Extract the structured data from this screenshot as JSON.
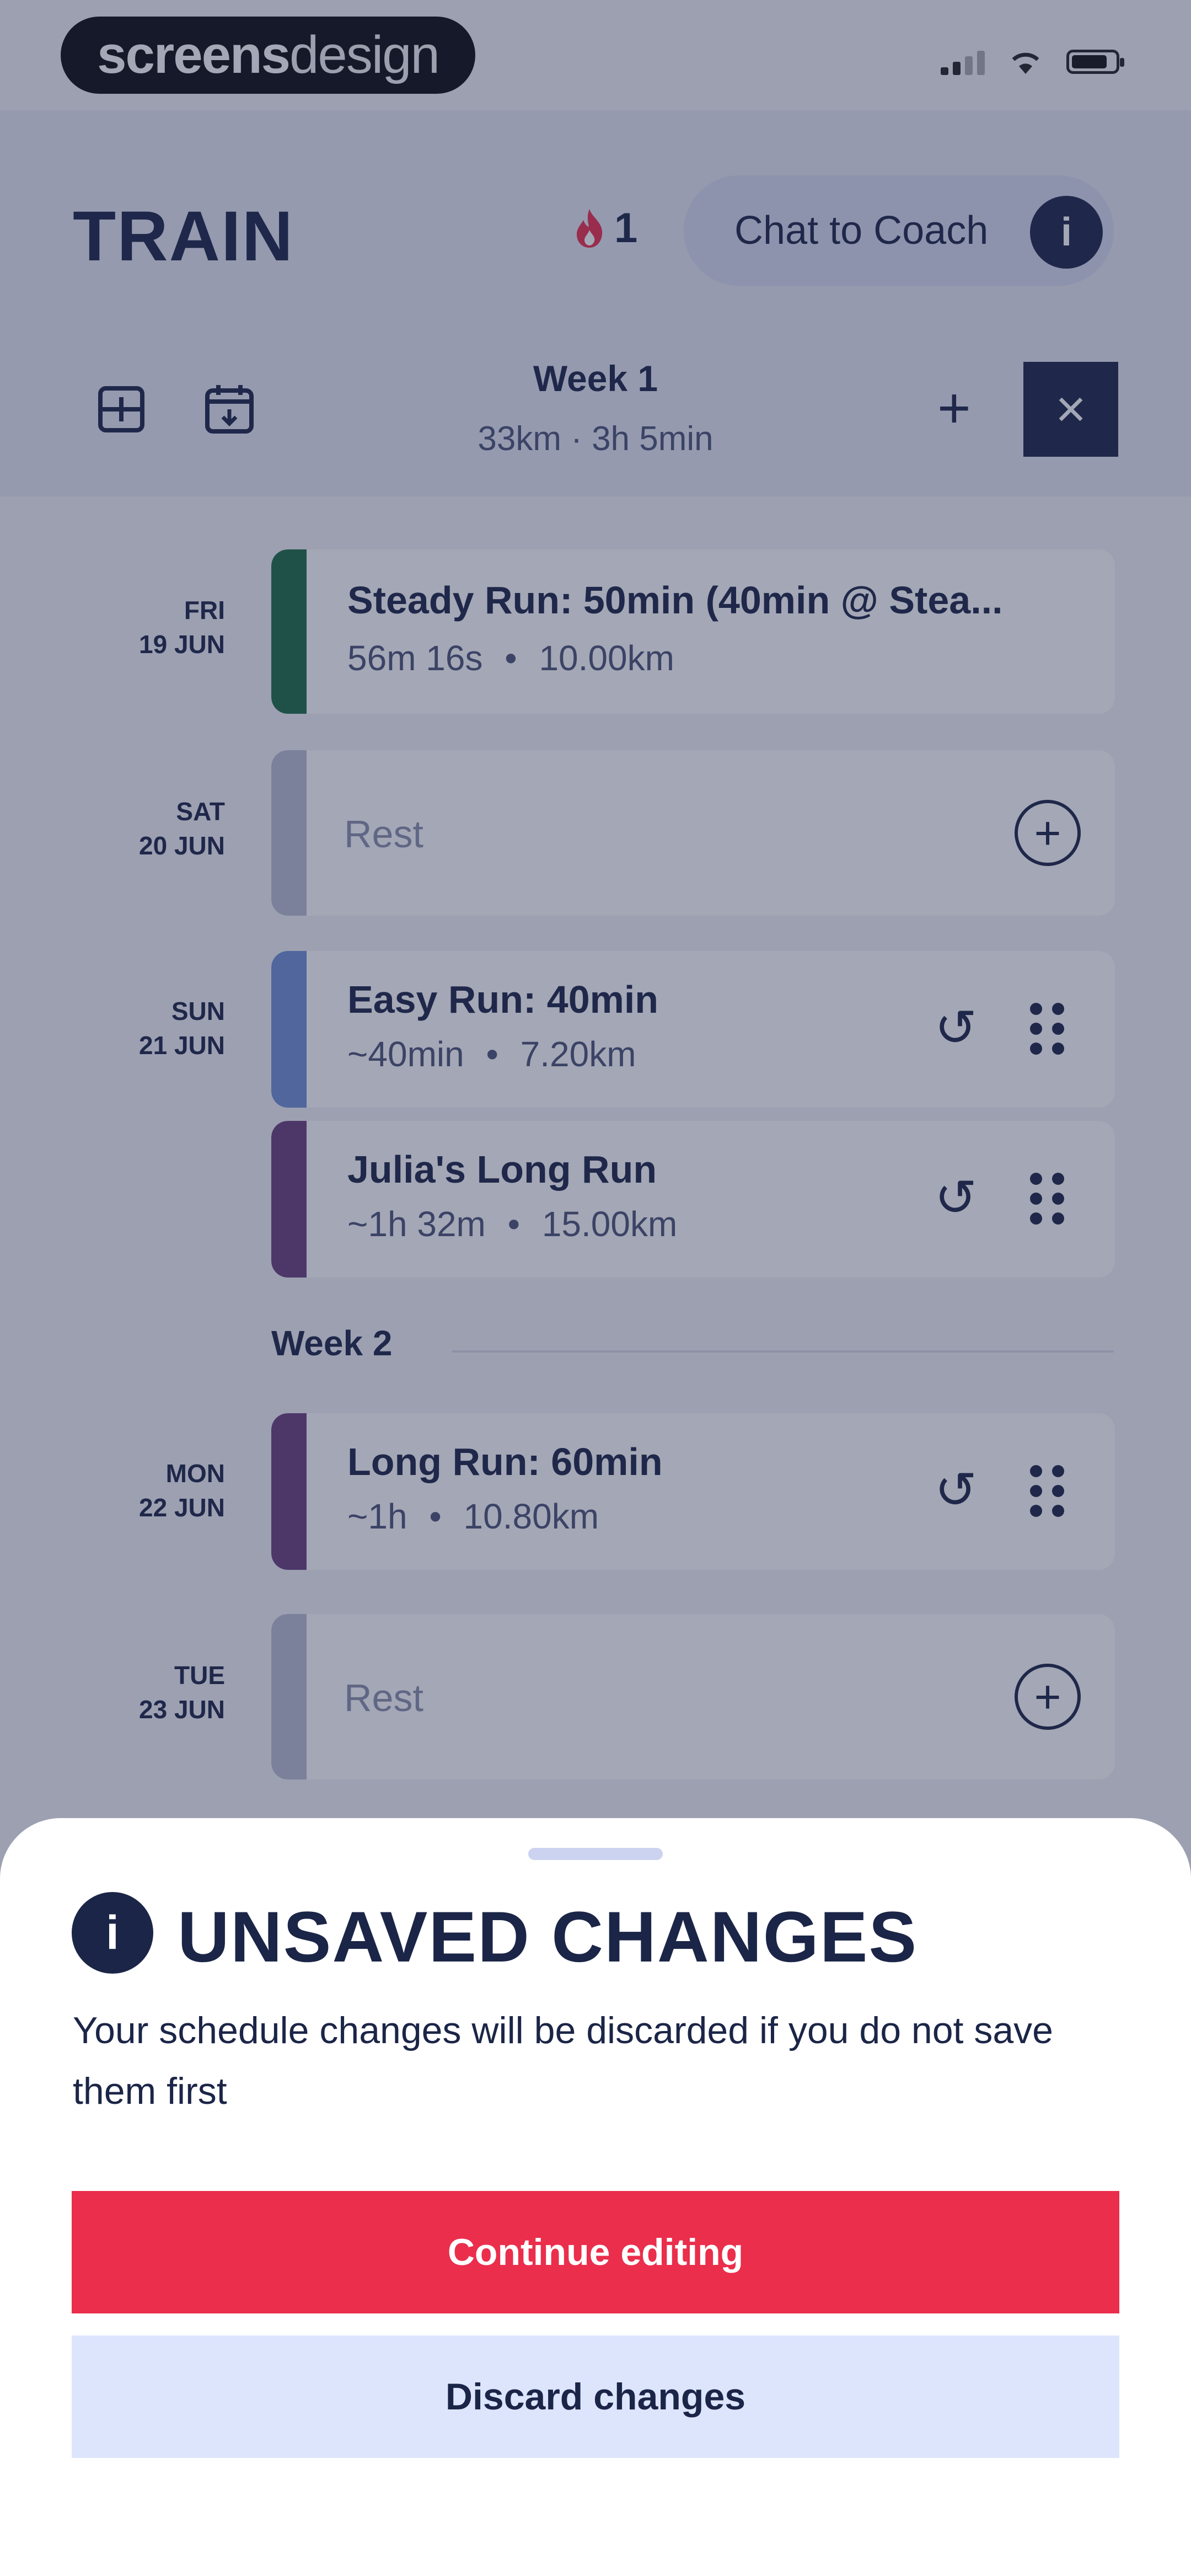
{
  "status_bar": {
    "brand_bold": "screens",
    "brand_light": "design"
  },
  "header": {
    "title": "TRAIN",
    "streak_count": "1",
    "chat_button_label": "Chat to Coach",
    "chat_info_glyph": "i"
  },
  "week_bar": {
    "week_title": "Week 1",
    "week_summary": "33km · 3h 5min",
    "plus_glyph": "+",
    "close_glyph": "×"
  },
  "schedule": {
    "days": [
      {
        "day": "FRI",
        "date": "19 JUN"
      },
      {
        "day": "SAT",
        "date": "20 JUN"
      },
      {
        "day": "SUN",
        "date": "21 JUN"
      },
      {
        "day": "MON",
        "date": "22 JUN"
      },
      {
        "day": "TUE",
        "date": "23 JUN"
      }
    ],
    "items": [
      {
        "title": "Steady Run: 50min (40min @ Stea...",
        "duration": "56m 16s",
        "distance": "10.00km",
        "color": "#1c6b46"
      },
      {
        "rest_label": "Rest",
        "color": "#b9bdd3"
      },
      {
        "title": "Easy Run: 40min",
        "duration": "~40min",
        "distance": "7.20km",
        "color": "#6e8fd6"
      },
      {
        "title": "Julia's Long Run",
        "duration": "~1h 32m",
        "distance": "15.00km",
        "color": "#6a3e7c"
      },
      {
        "title": "Long Run: 60min",
        "duration": "~1h",
        "distance": "10.80km",
        "color": "#6a3e7c"
      },
      {
        "rest_label": "Rest",
        "color": "#b9bdd3"
      }
    ],
    "week2_label": "Week 2",
    "separator": "•",
    "undo_glyph": "↺",
    "add_glyph": "+"
  },
  "dialog": {
    "icon_glyph": "i",
    "title": "UNSAVED CHANGES",
    "body": "Your schedule changes will be discarded if you do not save them first",
    "primary_label": "Continue editing",
    "secondary_label": "Discard changes"
  },
  "colors": {
    "navy": "#1b2547",
    "accent_red": "#ea2e4c",
    "secondary_button": "#dde5fd",
    "streak_flame": "#ea2e4c"
  },
  "icons": [
    "brand-logo",
    "cellular-signal-icon",
    "wifi-icon",
    "battery-icon",
    "flame-icon",
    "info-icon",
    "add-week-icon",
    "calendar-icon",
    "plus-icon",
    "close-icon",
    "undo-icon",
    "drag-handle-icon",
    "add-circle-icon"
  ]
}
